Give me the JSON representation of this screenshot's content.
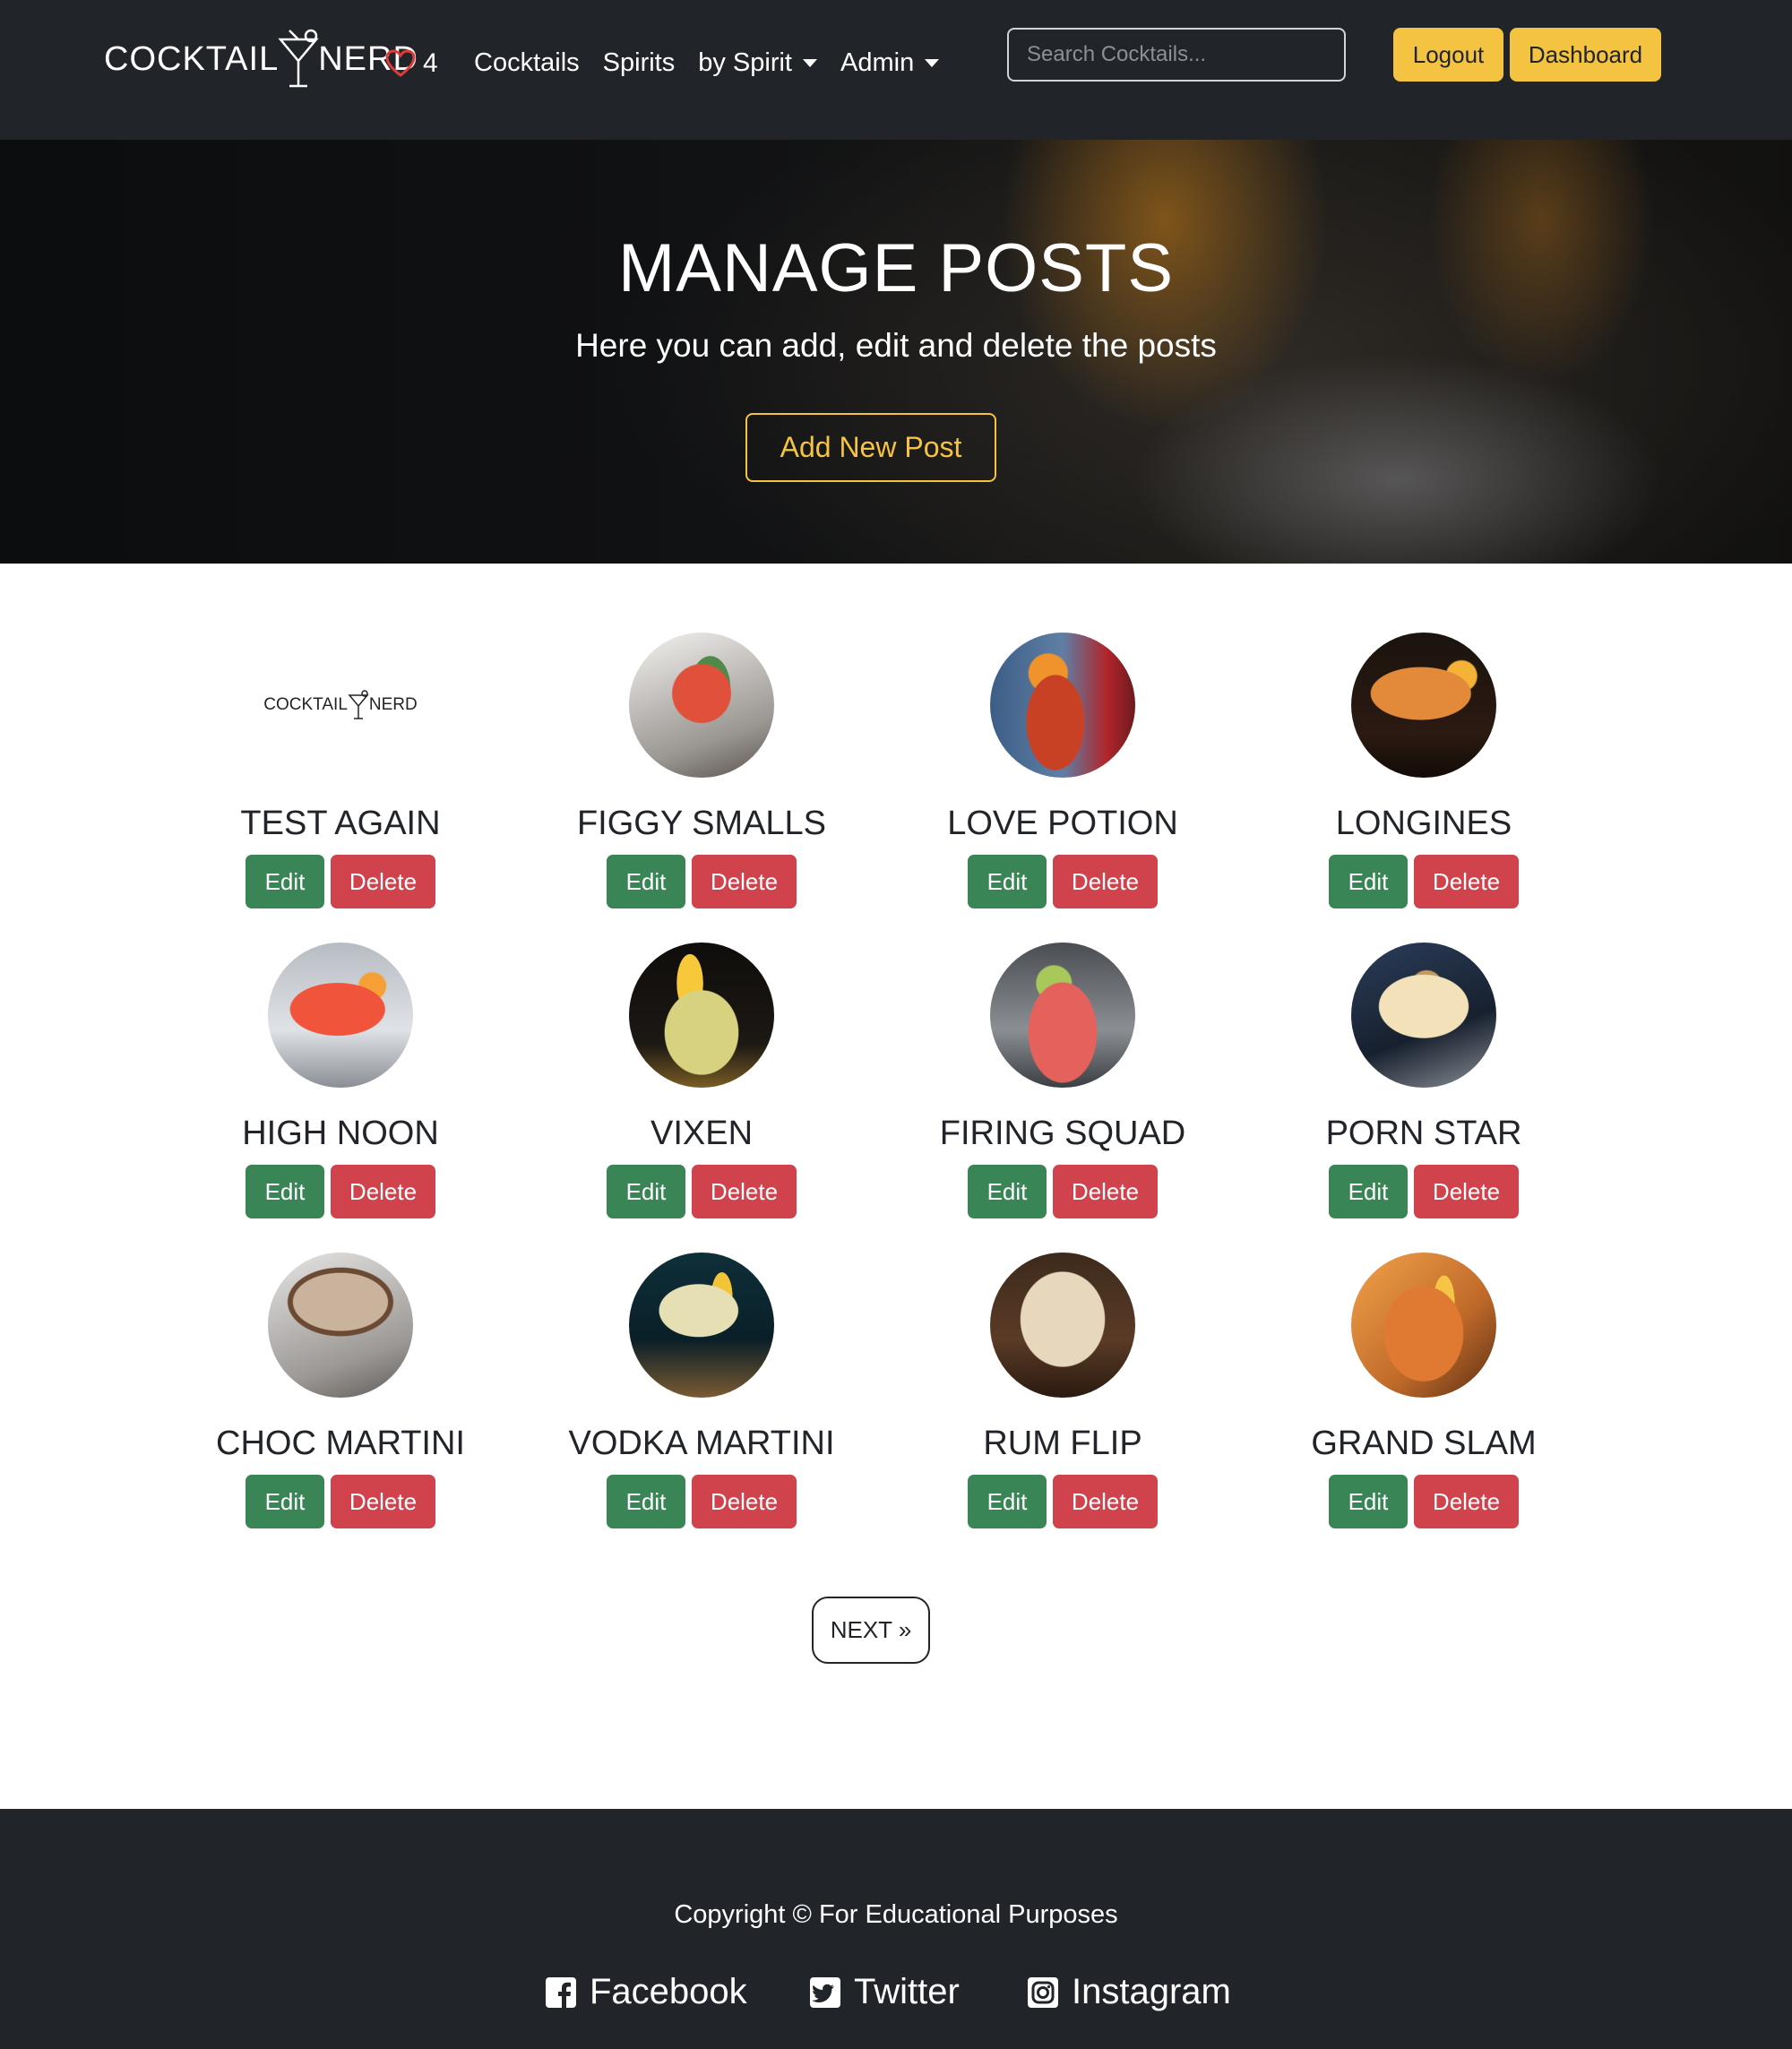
{
  "navbar": {
    "brand_left": "COCKTAIL",
    "brand_right": "NERD",
    "favorites_count": "4",
    "links": [
      "Cocktails",
      "Spirits",
      "by Spirit",
      "Admin"
    ],
    "search_placeholder": "Search Cocktails...",
    "logout_label": "Logout",
    "dashboard_label": "Dashboard",
    "accent_color": "#f5c342"
  },
  "hero": {
    "title": "MANAGE POSTS",
    "subtitle": "Here you can add, edit and delete the posts",
    "add_button": "Add New Post"
  },
  "posts": [
    {
      "title": "TEST AGAIN",
      "image": "logo"
    },
    {
      "title": "FIGGY SMALLS",
      "image": "red-coupe-basil"
    },
    {
      "title": "LOVE POTION",
      "image": "red-highball-orange"
    },
    {
      "title": "LONGINES",
      "image": "amber-coupe-dark"
    },
    {
      "title": "HIGH NOON",
      "image": "orange-coupe"
    },
    {
      "title": "VIXEN",
      "image": "rocks-glass-lemon"
    },
    {
      "title": "FIRING SQUAD",
      "image": "red-highball-lime"
    },
    {
      "title": "PORN STAR",
      "image": "passionfruit-coupe"
    },
    {
      "title": "CHOC MARTINI",
      "image": "chocolate-coupe"
    },
    {
      "title": "VODKA MARTINI",
      "image": "martini-lemon-twist"
    },
    {
      "title": "RUM FLIP",
      "image": "creamy-flip"
    },
    {
      "title": "GRAND SLAM",
      "image": "orange-highball"
    }
  ],
  "actions": {
    "edit_label": "Edit",
    "delete_label": "Delete"
  },
  "colors": {
    "edit": "#3a8556",
    "delete": "#d0424c",
    "dark": "#212529"
  },
  "pagination": {
    "next_label": "NEXT »"
  },
  "footer": {
    "copyright": "Copyright © For Educational Purposes",
    "links": [
      "Facebook",
      "Twitter",
      "Instagram"
    ]
  }
}
